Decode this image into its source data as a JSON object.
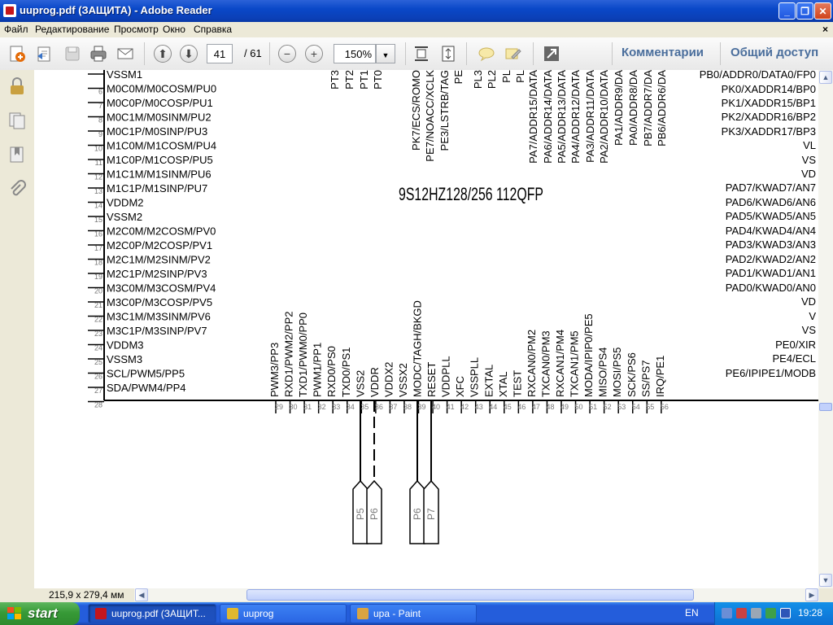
{
  "window": {
    "title": "uuprog.pdf (ЗАЩИТА) - Adobe Reader"
  },
  "menu": [
    "Файл",
    "Редактирование",
    "Просмотр",
    "Окно",
    "Справка"
  ],
  "toolbar": {
    "page_current": "41",
    "page_total": "/ 61",
    "zoom": "150%",
    "comments_label": "Комментарии",
    "share_label": "Общий доступ"
  },
  "status": {
    "page_size": "215,9 x 279,4 мм"
  },
  "taskbar": {
    "start": "start",
    "tasks": [
      "uuprog.pdf (ЗАЩИТ...",
      "uuprog",
      "upa - Paint"
    ],
    "lang": "EN",
    "time": "19:28"
  },
  "schematic": {
    "chip_title": "9S12HZ128/256 112QFP",
    "left_pins": [
      {
        "num": "",
        "label": "VSSM1"
      },
      {
        "num": "6",
        "label": "M0C0M/M0COSM/PU0"
      },
      {
        "num": "7",
        "label": "M0C0P/M0COSP/PU1"
      },
      {
        "num": "8",
        "label": "M0C1M/M0SINM/PU2"
      },
      {
        "num": "9",
        "label": "M0C1P/M0SINP/PU3"
      },
      {
        "num": "10",
        "label": "M1C0M/M1COSM/PU4"
      },
      {
        "num": "11",
        "label": "M1C0P/M1COSP/PU5"
      },
      {
        "num": "12",
        "label": "M1C1M/M1SINM/PU6"
      },
      {
        "num": "13",
        "label": "M1C1P/M1SINP/PU7"
      },
      {
        "num": "14",
        "label": "VDDM2"
      },
      {
        "num": "15",
        "label": "VSSM2"
      },
      {
        "num": "16",
        "label": "M2C0M/M2COSM/PV0"
      },
      {
        "num": "17",
        "label": "M2C0P/M2COSP/PV1"
      },
      {
        "num": "18",
        "label": "M2C1M/M2SINM/PV2"
      },
      {
        "num": "19",
        "label": "M2C1P/M2SINP/PV3"
      },
      {
        "num": "20",
        "label": "M3C0M/M3COSM/PV4"
      },
      {
        "num": "21",
        "label": "M3C0P/M3COSP/PV5"
      },
      {
        "num": "22",
        "label": "M3C1M/M3SINM/PV6"
      },
      {
        "num": "23",
        "label": "M3C1P/M3SINP/PV7"
      },
      {
        "num": "24",
        "label": "VDDM3"
      },
      {
        "num": "25",
        "label": "VSSM3"
      },
      {
        "num": "26",
        "label": "SCL/PWM5/PP5"
      },
      {
        "num": "27",
        "label": "SDA/PWM4/PP4"
      },
      {
        "num": "28",
        "label": ""
      }
    ],
    "right_pins": [
      "PB0/ADDR0/DATA0/FP0",
      "PK0/XADDR14/BP0",
      "PK1/XADDR15/BP1",
      "PK2/XADDR16/BP2",
      "PK3/XADDR17/BP3",
      "VL",
      "VS",
      "VD",
      "PAD7/KWAD7/AN7",
      "PAD6/KWAD6/AN6",
      "PAD5/KWAD5/AN5",
      "PAD4/KWAD4/AN4",
      "PAD3/KWAD3/AN3",
      "PAD2/KWAD2/AN2",
      "PAD1/KWAD1/AN1",
      "PAD0/KWAD0/AN0",
      "VD",
      "V",
      "VS",
      "PE0/XIR",
      "PE4/ECL",
      "PE6/IPIPE1/MODB"
    ],
    "top_pins": [
      "PT3",
      "PT2",
      "PT1",
      "PT0",
      "PK7/ECS/ROMO",
      "PE7/NOACC/XCLK",
      "PE3/LSTRB/TAG",
      "PE",
      "PL3",
      "PL2",
      "PL",
      "PL",
      "PA7/ADDR15/DATA",
      "PA6/ADDR14/DATA",
      "PA5/ADDR13/DATA",
      "PA4/ADDR12/DATA",
      "PA3/ADDR11/DATA",
      "PA2/ADDR10/DATA",
      "PA1/ADDR9/DA",
      "PA0/ADDR8/DA",
      "PB7/ADDR7/DA",
      "PB6/ADDR6/DA"
    ],
    "bottom_pins": [
      {
        "num": "29",
        "label": "PWM3/PP3"
      },
      {
        "num": "30",
        "label": "RXD1/PWM2/PP2"
      },
      {
        "num": "31",
        "label": "TXD1/PWM0/PP0"
      },
      {
        "num": "32",
        "label": "PWM1/PP1"
      },
      {
        "num": "33",
        "label": "RXD0/PS0"
      },
      {
        "num": "34",
        "label": "TXD0/PS1"
      },
      {
        "num": "35",
        "label": "VSS2"
      },
      {
        "num": "36",
        "label": "VDDR"
      },
      {
        "num": "37",
        "label": "VDDX2"
      },
      {
        "num": "38",
        "label": "VSSX2"
      },
      {
        "num": "39",
        "label": "MODC/TAGH/BKGD"
      },
      {
        "num": "40",
        "label": "RESET"
      },
      {
        "num": "41",
        "label": "VDDPLL"
      },
      {
        "num": "42",
        "label": "XFC"
      },
      {
        "num": "43",
        "label": "VSSPLL"
      },
      {
        "num": "44",
        "label": "EXTAL"
      },
      {
        "num": "45",
        "label": "XTAL"
      },
      {
        "num": "46",
        "label": "TEST"
      },
      {
        "num": "47",
        "label": "RXCAN0/PM2"
      },
      {
        "num": "48",
        "label": "TXCAN0/PM3"
      },
      {
        "num": "49",
        "label": "RXCAN1/PM4"
      },
      {
        "num": "50",
        "label": "TXCAN1/PM5"
      },
      {
        "num": "51",
        "label": "MODA/IPIP0/PE5"
      },
      {
        "num": "52",
        "label": "MISO/PS4"
      },
      {
        "num": "53",
        "label": "MOSI/PS5"
      },
      {
        "num": "54",
        "label": "SCK/PS6"
      },
      {
        "num": "55",
        "label": "SS/PS7"
      },
      {
        "num": "56",
        "label": "IRQ/PE1"
      }
    ],
    "connectors": [
      "P5",
      "P6",
      "P6",
      "P7"
    ]
  }
}
